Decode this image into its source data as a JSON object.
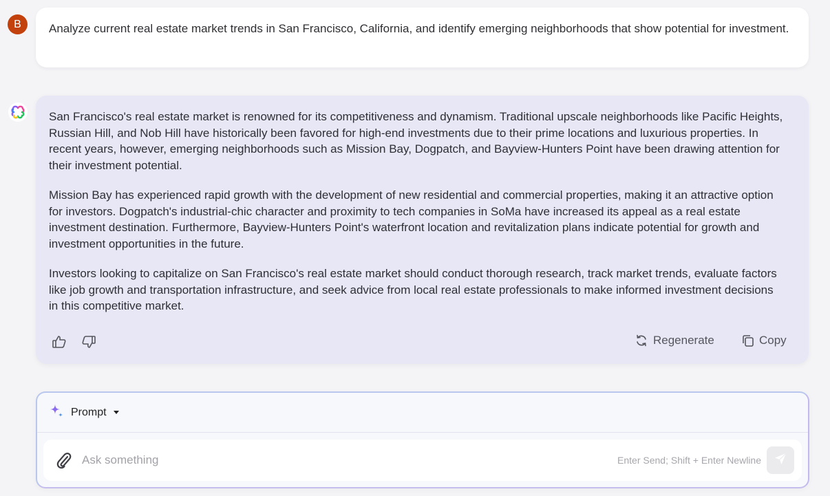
{
  "user": {
    "avatar_letter": "B",
    "message": "Analyze current real estate market trends in San Francisco, California, and identify emerging neighborhoods that show potential for investment."
  },
  "assistant": {
    "logo_icon": "multicolor-clover-logo",
    "paragraphs": [
      "San Francisco's real estate market is renowned for its competitiveness and dynamism. Traditional upscale neighborhoods like Pacific Heights, Russian Hill, and Nob Hill have historically been favored for high-end investments due to their prime locations and luxurious properties. In recent years, however, emerging neighborhoods such as Mission Bay, Dogpatch, and Bayview-Hunters Point have been drawing attention for their investment potential.",
      "Mission Bay has experienced rapid growth with the development of new residential and commercial properties, making it an attractive option for investors. Dogpatch's industrial-chic character and proximity to tech companies in SoMa have increased its appeal as a real estate investment destination. Furthermore, Bayview-Hunters Point's waterfront location and revitalization plans indicate potential for growth and investment opportunities in the future.",
      "Investors looking to capitalize on San Francisco's real estate market should conduct thorough research, track market trends, evaluate factors like job growth and transportation infrastructure, and seek advice from local real estate professionals to make informed investment decisions in this competitive market."
    ],
    "actions": {
      "like_icon": "thumbs-up-icon",
      "dislike_icon": "thumbs-down-icon",
      "regenerate_label": "Regenerate",
      "copy_label": "Copy"
    }
  },
  "composer": {
    "mode_label": "Prompt",
    "placeholder": "Ask something",
    "value": "",
    "hint": "Enter Send; Shift + Enter Newline"
  },
  "colors": {
    "avatar": "#c2410c",
    "assistant_bubble": "#e7e7f5",
    "sparkle": "#8b6cf0"
  }
}
